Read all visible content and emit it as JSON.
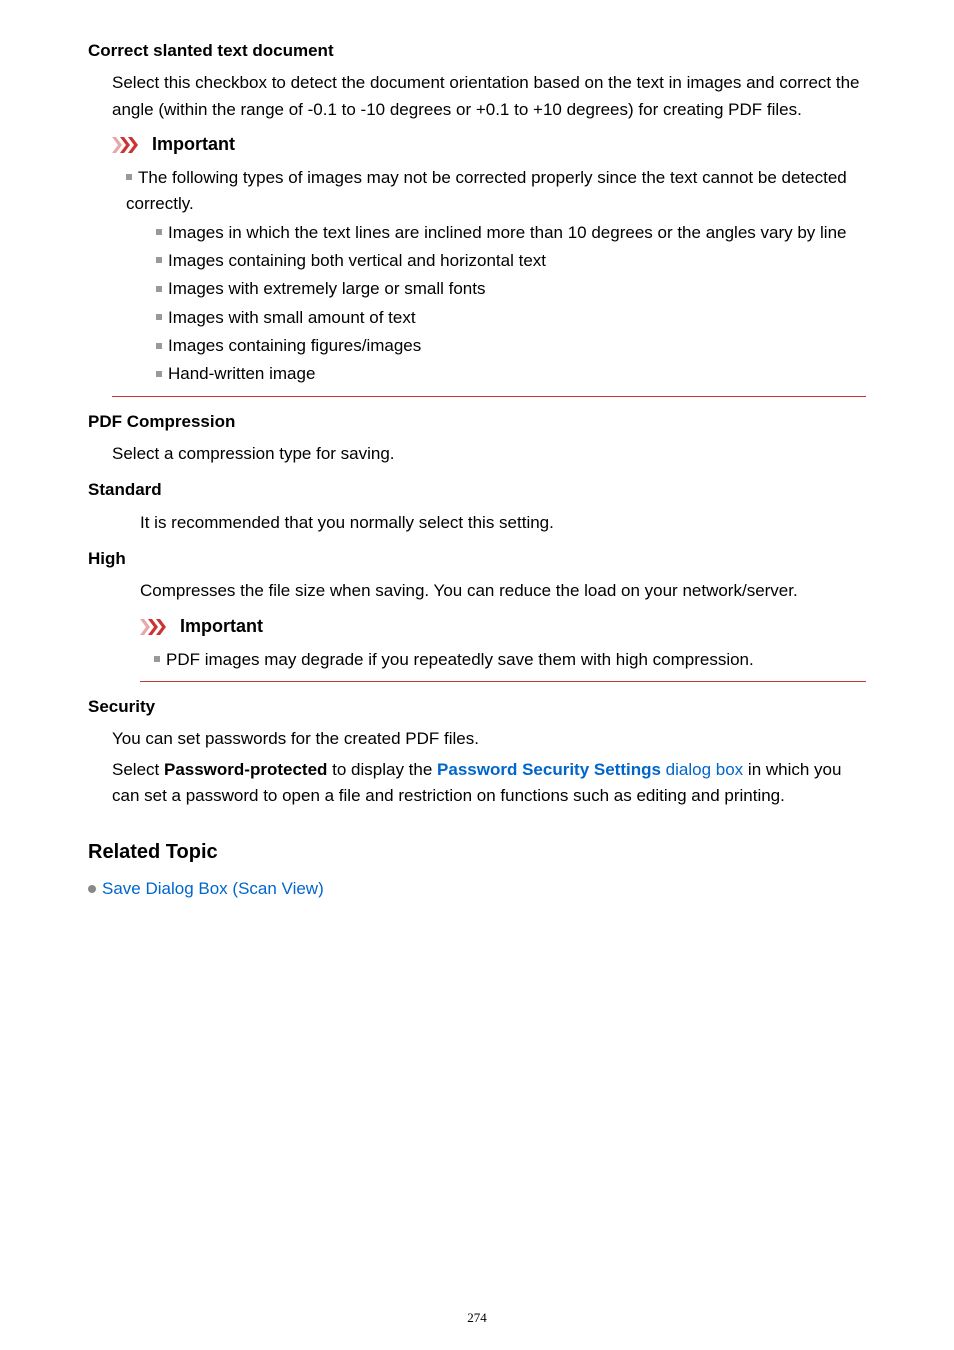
{
  "correct": {
    "heading": "Correct slanted text document",
    "para": "Select this checkbox to detect the document orientation based on the text in images and correct the angle (within the range of -0.1 to -10 degrees or +0.1 to +10 degrees) for creating PDF files."
  },
  "important1": {
    "title": "Important",
    "lead": "The following types of images may not be corrected properly since the text cannot be detected correctly.",
    "items": [
      "Images in which the text lines are inclined more than 10 degrees or the angles vary by line",
      "Images containing both vertical and horizontal text",
      "Images with extremely large or small fonts",
      "Images with small amount of text",
      "Images containing figures/images",
      "Hand-written image"
    ]
  },
  "pdfcomp": {
    "heading": "PDF Compression",
    "para": "Select a compression type for saving.",
    "standard": {
      "heading": "Standard",
      "para": "It is recommended that you normally select this setting."
    },
    "high": {
      "heading": "High",
      "para": "Compresses the file size when saving. You can reduce the load on your network/server."
    }
  },
  "important2": {
    "title": "Important",
    "item": "PDF images may degrade if you repeatedly save them with high compression."
  },
  "security": {
    "heading": "Security",
    "para1": "You can set passwords for the created PDF files.",
    "p2_a": "Select ",
    "p2_bold": "Password-protected",
    "p2_b": " to display the ",
    "p2_link_bold": "Password Security Settings",
    "p2_link_tail": " dialog box",
    "p2_c": " in which you can set a password to open a file and restriction on functions such as editing and printing."
  },
  "related": {
    "heading": "Related Topic",
    "link": "Save Dialog Box (Scan View)"
  },
  "pagenum": "274"
}
